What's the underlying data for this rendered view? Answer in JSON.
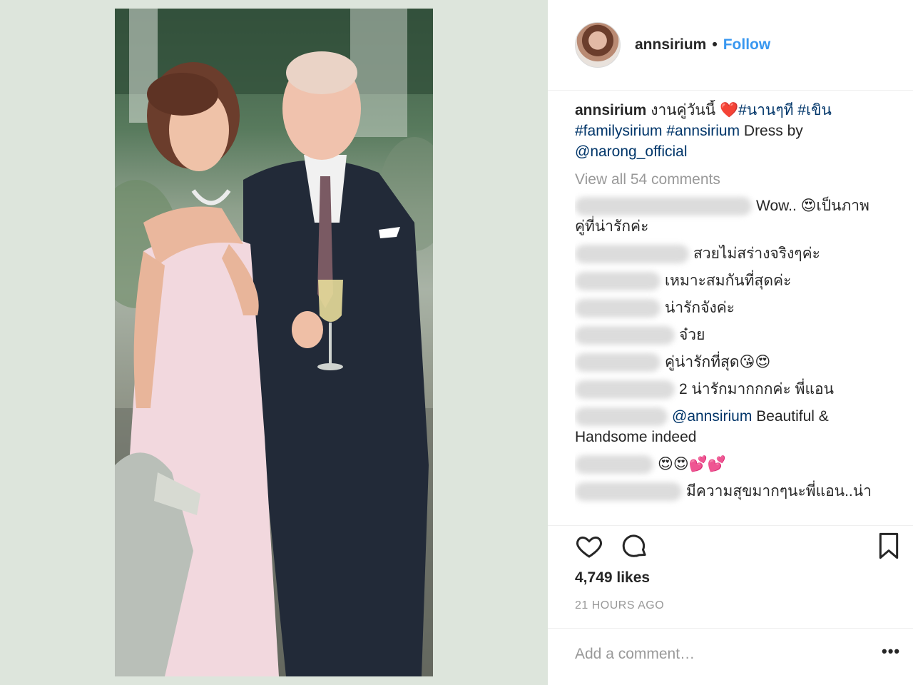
{
  "post": {
    "username": "annsirium",
    "separator": "•",
    "follow_label": "Follow",
    "caption": {
      "username": "annsirium",
      "text": " งานคู่วันนี้ ",
      "heart": "❤️",
      "tags1": "#นานๆที #เขิน",
      "tags2": "#familysirium #annsirium",
      "text2": " Dress by",
      "mention": "@narong_official"
    },
    "view_all_label": "View all 54 comments",
    "comments": [
      {
        "text": "Wow.. 😍เป็นภาพ",
        "text2": "คู่ที่น่ารักค่ะ"
      },
      {
        "text": "สวยไม่สร่างจริงๆค่ะ"
      },
      {
        "text": "เหมาะสมกันที่สุดค่ะ"
      },
      {
        "text": "น่ารักจังค่ะ"
      },
      {
        "text": "จ๋วย"
      },
      {
        "text": "คู่น่ารักที่สุด😘😍"
      },
      {
        "text": "2 น่ารักมากกกค่ะ พี่แอน"
      },
      {
        "mention": "@annsirium",
        "text": " Beautiful &",
        "text2": "Handsome indeed"
      },
      {
        "text": "😍😍💕💕"
      },
      {
        "text": "มีความสุขมากๆนะพี่แอน..น่า"
      }
    ],
    "likes": "4,749 likes",
    "time": "21 HOURS AGO",
    "add_comment_placeholder": "Add a comment…",
    "more_label": "•••"
  },
  "icons": {
    "like": "heart-outline-icon",
    "comment": "comment-bubble-icon",
    "save": "bookmark-icon"
  },
  "colors": {
    "link": "#3897f0",
    "hashtag": "#003569",
    "muted": "#999999",
    "panel_bg": "#dde5dc"
  }
}
